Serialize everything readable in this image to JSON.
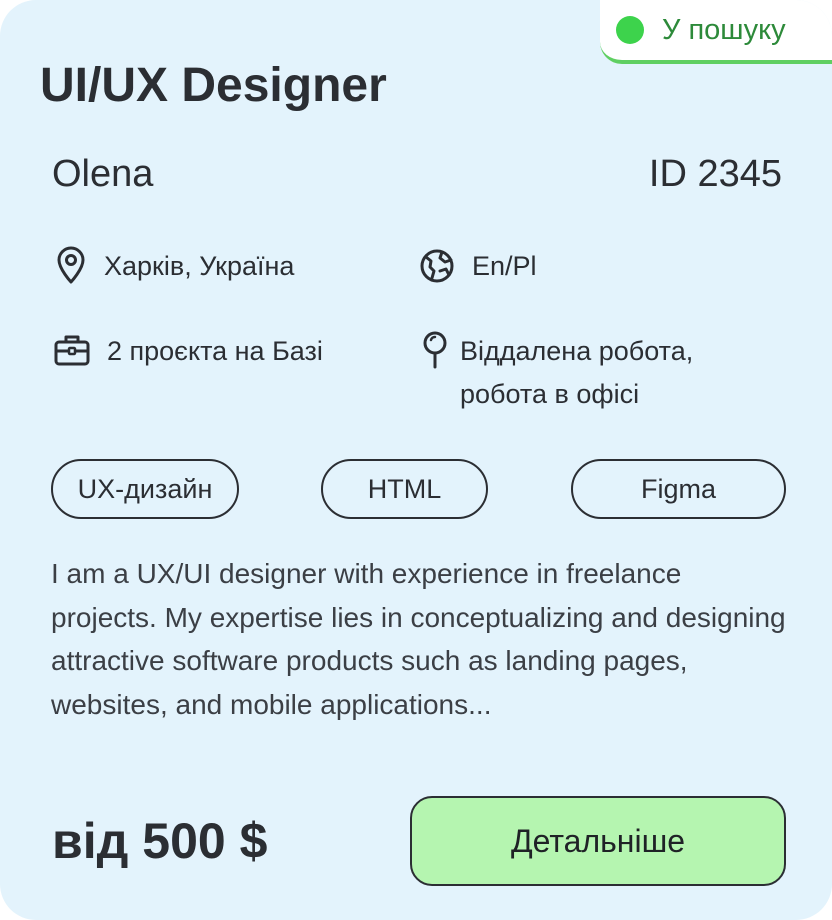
{
  "card": {
    "status_label": "У пошуку",
    "title": "UI/UX Designer",
    "name": "Olena",
    "id_label": "ID 2345",
    "info": {
      "location": "Харків, Україна",
      "languages": "En/Pl",
      "projects": "2 проєкта на Базі",
      "work_type_line1": "Віддалена робота,",
      "work_type_line2": "робота в офісі"
    },
    "tags": [
      "UX-дизайн",
      "HTML",
      "Figma"
    ],
    "description": "I am a UX/UI designer with experience in freelance projects. My expertise lies in conceptualizing and designing attractive software products such as landing pages, websites, and mobile applications...",
    "price": "від 500 $",
    "details_button": "Детальніше"
  },
  "colors": {
    "card_bg": "#e3f3fc",
    "status_dot": "#3dd34c",
    "button_bg": "#b5f5b0",
    "text": "#2b2e33"
  },
  "icons": {
    "location": "map-pin-icon",
    "languages": "globe-icon",
    "projects": "briefcase-icon",
    "work_type": "pin-icon"
  }
}
